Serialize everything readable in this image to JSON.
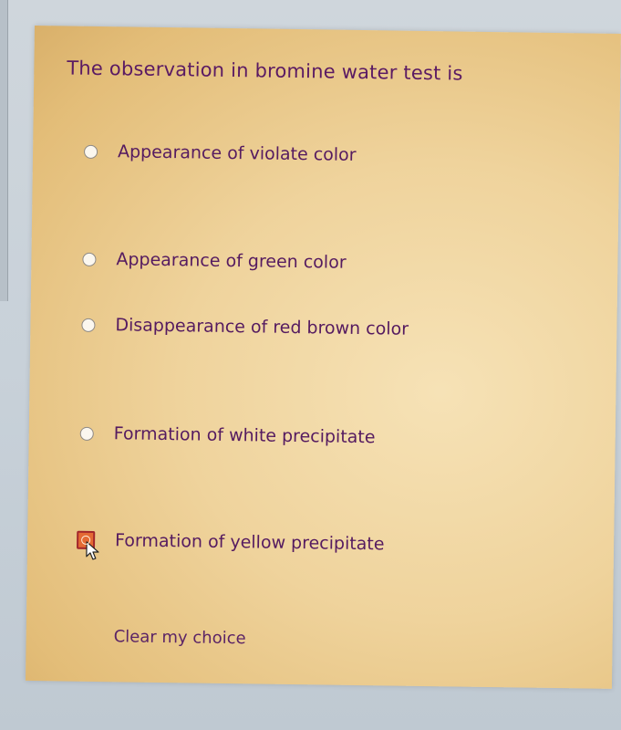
{
  "quiz": {
    "question": "The observation in bromine water test is",
    "options": [
      {
        "label": "Appearance of violate  color",
        "selected": false
      },
      {
        "label": "Appearance of green color",
        "selected": false
      },
      {
        "label": "Disappearance of red brown color",
        "selected": false
      },
      {
        "label": "Formation of white precipitate",
        "selected": false
      },
      {
        "label": "Formation of yellow precipitate",
        "selected": true
      }
    ],
    "clear_label": "Clear my choice"
  },
  "colors": {
    "panel_background": "#efd39c",
    "text": "#551b60",
    "selected_radio": "#e46a34"
  },
  "icons": {
    "cursor": "mouse-pointer-icon"
  }
}
